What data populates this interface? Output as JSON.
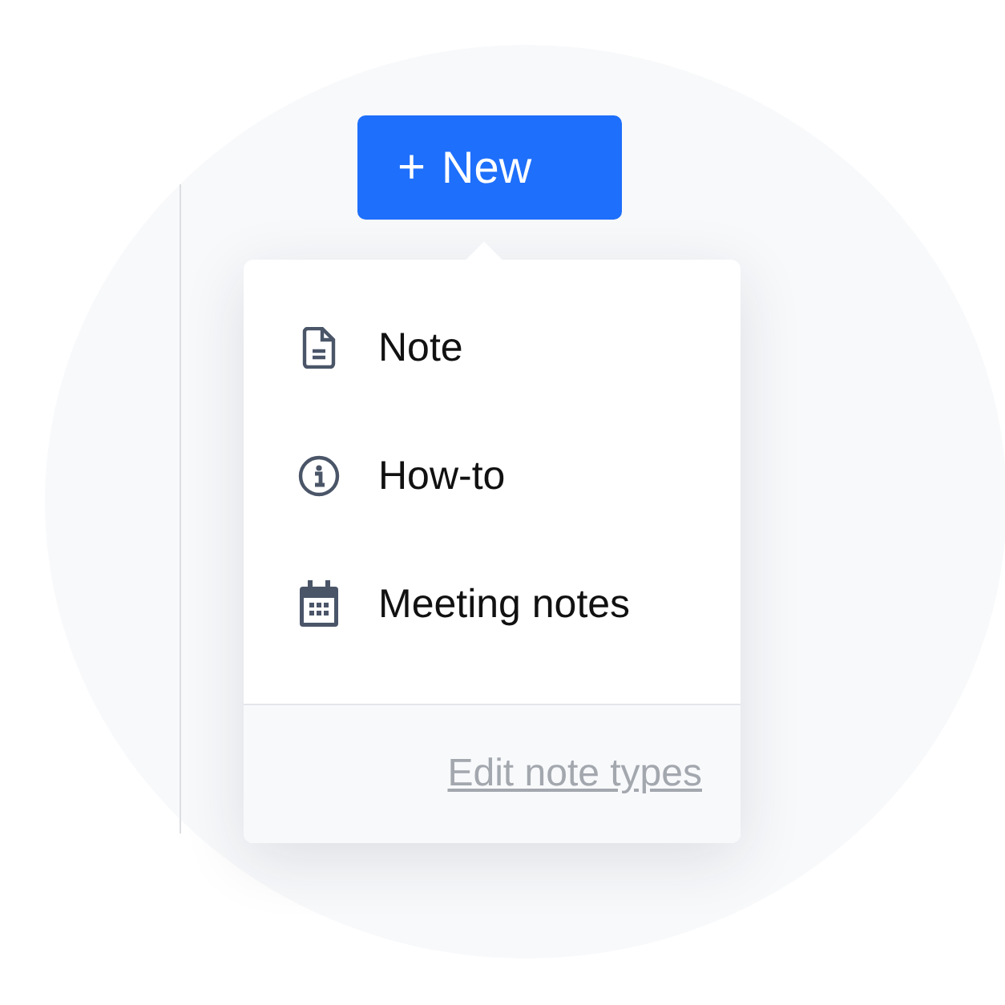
{
  "new_button": {
    "label": "New",
    "icon": "+"
  },
  "menu": {
    "items": [
      {
        "kind": "note",
        "label": "Note"
      },
      {
        "kind": "howto",
        "label": "How-to"
      },
      {
        "kind": "meeting",
        "label": "Meeting notes"
      }
    ],
    "footer_link": "Edit note types"
  }
}
